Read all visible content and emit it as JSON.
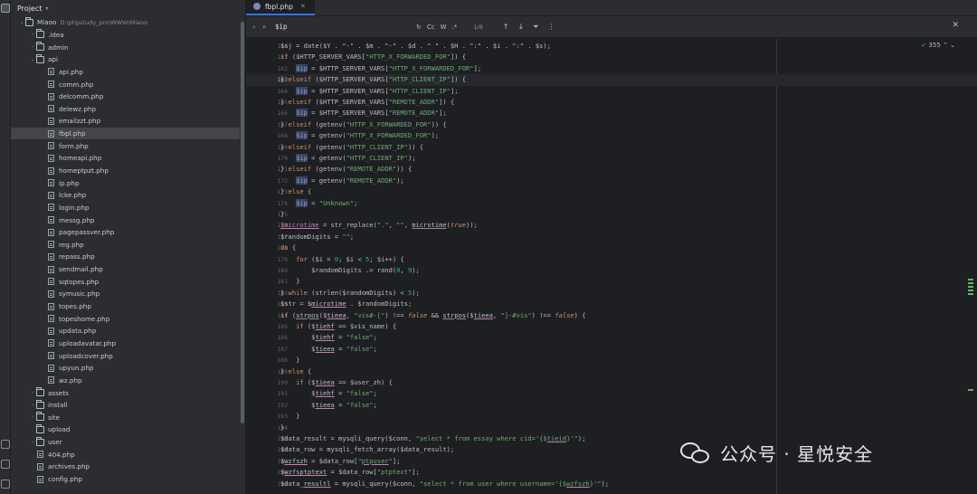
{
  "project_panel": {
    "title": "Project",
    "tree": [
      {
        "label": "Miaoo",
        "path": "D:\\phpstudy_pro\\WWW\\Miaoo",
        "type": "folder",
        "depth": 0,
        "expanded": true
      },
      {
        "label": ".idea",
        "type": "folder",
        "depth": 1,
        "expanded": false
      },
      {
        "label": "admin",
        "type": "folder",
        "depth": 1,
        "expanded": false
      },
      {
        "label": "api",
        "type": "folder",
        "depth": 1,
        "expanded": true
      },
      {
        "label": "api.php",
        "type": "file",
        "depth": 2
      },
      {
        "label": "comm.php",
        "type": "file",
        "depth": 2
      },
      {
        "label": "delcomm.php",
        "type": "file",
        "depth": 2
      },
      {
        "label": "delewz.php",
        "type": "file",
        "depth": 2
      },
      {
        "label": "emailzzt.php",
        "type": "file",
        "depth": 2
      },
      {
        "label": "fbpl.php",
        "type": "file",
        "depth": 2,
        "selected": true
      },
      {
        "label": "form.php",
        "type": "file",
        "depth": 2
      },
      {
        "label": "homeapi.php",
        "type": "file",
        "depth": 2
      },
      {
        "label": "homeptpzt.php",
        "type": "file",
        "depth": 2
      },
      {
        "label": "ip.php",
        "type": "file",
        "depth": 2
      },
      {
        "label": "lcke.php",
        "type": "file",
        "depth": 2
      },
      {
        "label": "login.php",
        "type": "file",
        "depth": 2
      },
      {
        "label": "messg.php",
        "type": "file",
        "depth": 2
      },
      {
        "label": "pagepassver.php",
        "type": "file",
        "depth": 2
      },
      {
        "label": "reg.php",
        "type": "file",
        "depth": 2
      },
      {
        "label": "repass.php",
        "type": "file",
        "depth": 2
      },
      {
        "label": "sendmail.php",
        "type": "file",
        "depth": 2
      },
      {
        "label": "sqtopes.php",
        "type": "file",
        "depth": 2
      },
      {
        "label": "symusic.php",
        "type": "file",
        "depth": 2
      },
      {
        "label": "topes.php",
        "type": "file",
        "depth": 2
      },
      {
        "label": "topeshome.php",
        "type": "file",
        "depth": 2
      },
      {
        "label": "updata.php",
        "type": "file",
        "depth": 2
      },
      {
        "label": "uploadavatar.php",
        "type": "file",
        "depth": 2
      },
      {
        "label": "uploadcover.php",
        "type": "file",
        "depth": 2
      },
      {
        "label": "upyun.php",
        "type": "file",
        "depth": 2
      },
      {
        "label": "wz.php",
        "type": "file",
        "depth": 2
      },
      {
        "label": "assets",
        "type": "folder",
        "depth": 1,
        "expanded": false
      },
      {
        "label": "install",
        "type": "folder",
        "depth": 1,
        "expanded": false
      },
      {
        "label": "site",
        "type": "folder",
        "depth": 1,
        "expanded": false
      },
      {
        "label": "upload",
        "type": "folder",
        "depth": 1,
        "expanded": false,
        "noarrow": true
      },
      {
        "label": "user",
        "type": "folder",
        "depth": 1,
        "expanded": false
      },
      {
        "label": "404.php",
        "type": "file",
        "depth": 1
      },
      {
        "label": "archives.php",
        "type": "file",
        "depth": 1
      },
      {
        "label": "config.php",
        "type": "file",
        "depth": 1
      }
    ]
  },
  "editor": {
    "tab_label": "fbpl.php",
    "search": {
      "query": "$ip",
      "match_case": "Cc",
      "words": "W",
      "regex": ".*",
      "count": "1/8"
    },
    "inspections": "355",
    "current_line": 163,
    "lines": [
      {
        "n": 160,
        "html": "$sj = date($Y . \"-\" . $m . \"-\" . $d . \" \" . $H . \":\" . $i . \":\" . $s);"
      },
      {
        "n": 161,
        "html": "<span class='kw'>if</span> ($HTTP_SERVER_VARS[<span class='st'>\"HTTP_X_FORWARDED_FOR\"</span>]) {"
      },
      {
        "n": 162,
        "html": "    <span class='hl'>$ip</span> = $HTTP_SERVER_VARS[<span class='st'>\"HTTP_X_FORWARDED_FOR\"</span>];"
      },
      {
        "n": 163,
        "html": "} <span class='kw'>elseif</span> ($HTTP_SERVER_VARS[<span class='st'>\"HTTP_CLIENT_IP\"</span>]) {"
      },
      {
        "n": 164,
        "html": "    <span class='hl'>$ip</span> = $HTTP_SERVER_VARS[<span class='st'>\"HTTP_CLIENT_IP\"</span>];"
      },
      {
        "n": 165,
        "html": "} <span class='kw'>elseif</span> ($HTTP_SERVER_VARS[<span class='st'>\"REMOTE_ADDR\"</span>]) {"
      },
      {
        "n": 166,
        "html": "    <span class='hl'>$ip</span> = $HTTP_SERVER_VARS[<span class='st'>\"REMOTE_ADDR\"</span>];"
      },
      {
        "n": 167,
        "html": "} <span class='kw'>elseif</span> (getenv(<span class='st'>\"HTTP_X_FORWARDED_FOR\"</span>)) {"
      },
      {
        "n": 168,
        "html": "    <span class='hl'>$ip</span> = getenv(<span class='st'>\"HTTP_X_FORWARDED_FOR\"</span>);"
      },
      {
        "n": 169,
        "html": "} <span class='kw'>elseif</span> (getenv(<span class='st'>\"HTTP_CLIENT_IP\"</span>)) {"
      },
      {
        "n": 170,
        "html": "    <span class='hl'>$ip</span> = getenv(<span class='st'>\"HTTP_CLIENT_IP\"</span>);"
      },
      {
        "n": 171,
        "html": "} <span class='kw'>elseif</span> (getenv(<span class='st'>\"REMOTE_ADDR\"</span>)) {"
      },
      {
        "n": 172,
        "html": "    <span class='hl'>$ip</span> = getenv(<span class='st'>\"REMOTE_ADDR\"</span>);"
      },
      {
        "n": 173,
        "html": "} <span class='kw'>else</span> {"
      },
      {
        "n": 174,
        "html": "    <span class='hl'>$ip</span> = <span class='st'>\"Unknown\"</span>;"
      },
      {
        "n": 175,
        "html": "}"
      },
      {
        "n": 176,
        "html": "<span class='vr ul'>$microtime</span> = str_replace(<span class='st'>\".\"</span>, <span class='st'>\"\"</span>, <span class='fn'>microtime</span>(<span class='it'>true</span>));"
      },
      {
        "n": 177,
        "html": "$randomDigits = <span class='st'>\"\"</span>;"
      },
      {
        "n": 178,
        "html": "<span class='kw'>do</span> {"
      },
      {
        "n": 179,
        "html": "    <span class='kw'>for</span> ($i = <span class='nm'>0</span>; $i &lt; <span class='nm'>5</span>; $i++) {"
      },
      {
        "n": 180,
        "html": "        $randomDigits .= rand(<span class='nm'>0</span>, <span class='nm'>9</span>);"
      },
      {
        "n": 181,
        "html": "    }"
      },
      {
        "n": 182,
        "html": "} <span class='kw'>while</span> (strlen($randomDigits) &lt; <span class='nm'>5</span>);"
      },
      {
        "n": 183,
        "html": "$str = $<span class='ul'>microtime</span> . $randomDigits;"
      },
      {
        "n": 184,
        "html": "<span class='kw'>if</span> (<span class='fn'>strpos</span>($<span class='ul'>tieea</span>, <span class='st'>\"vis#-[\"</span>) !== <span class='it'>false</span> &amp;&amp; <span class='fn'>strpos</span>($<span class='ul'>tieea</span>, <span class='st'>\"]-#vis\"</span>) !== <span class='it'>false</span>) {"
      },
      {
        "n": 185,
        "html": "    <span class='kw'>if</span> ($<span class='ul'>tiehf</span> == $vis_name) {"
      },
      {
        "n": 186,
        "html": "        $<span class='ul'>tiehf</span> = <span class='st'>\"false\"</span>;"
      },
      {
        "n": 187,
        "html": "        $<span class='ul'>tieea</span> = <span class='st'>\"false\"</span>;"
      },
      {
        "n": 188,
        "html": "    }"
      },
      {
        "n": 189,
        "html": "} <span class='kw'>else</span> {"
      },
      {
        "n": 190,
        "html": "    <span class='kw'>if</span> ($<span class='ul'>tieea</span> == $user_zh) {"
      },
      {
        "n": 191,
        "html": "        $<span class='ul'>tiehf</span> = <span class='st'>\"false\"</span>;"
      },
      {
        "n": 192,
        "html": "        $<span class='ul'>tieea</span> = <span class='st'>\"false\"</span>;"
      },
      {
        "n": 193,
        "html": "    }"
      },
      {
        "n": 194,
        "html": "}"
      },
      {
        "n": 195,
        "html": "$data_result = mysqli_query($conn, <span class='st'>\"select * from essay where cid='{$<span class='ul'>tieid</span>}'\"</span>);"
      },
      {
        "n": 196,
        "html": "$data_row = mysqli_fetch_array($data_result);"
      },
      {
        "n": 197,
        "html": "$<span class='ul'>wzfszh</span> = $data_row[<span class='st'>\"<span class='ul'>ptpuser</span>\"</span>];"
      },
      {
        "n": 198,
        "html": "$<span class='ul'>wzfsptptext</span> = $data_row[<span class='st'>\"ptptext\"</span>];"
      },
      {
        "n": 199,
        "html": "$data_<span class='ul'>resultl</span> = mysqli_query($conn, <span class='st'>\"select * from user where username='{$<span class='ul'>wzfszh</span>}'\"</span>);"
      }
    ]
  },
  "watermark": {
    "text": "公众号 · 星悦安全"
  }
}
